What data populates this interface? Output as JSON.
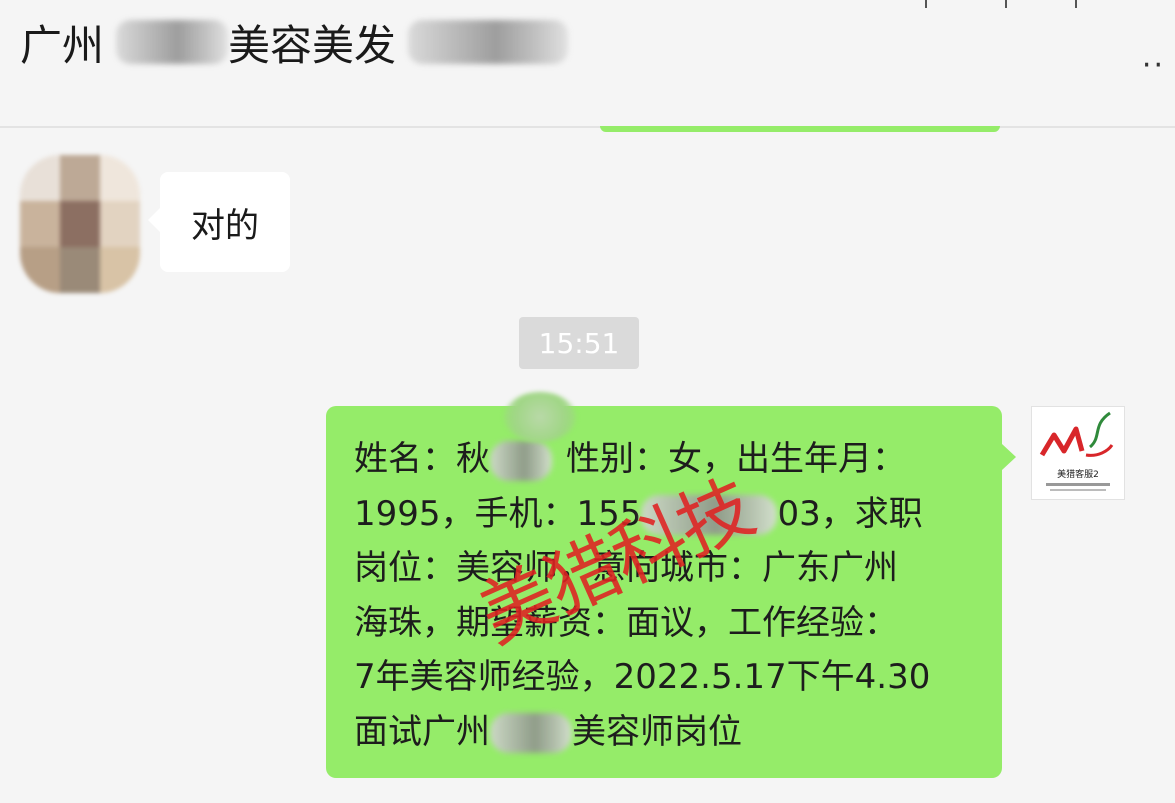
{
  "header": {
    "title_prefix": "广州",
    "title_middle": "美容美发",
    "more_icon": "ellipsis-icon"
  },
  "colors": {
    "self_bubble": "#95ec69",
    "other_bubble": "#ffffff",
    "background": "#f5f5f5",
    "watermark": "#e02222"
  },
  "messages": {
    "incoming_text": "对的",
    "timestamp": "15:51",
    "outgoing_lines": [
      {
        "a": "姓名：秋",
        "b": "性别：女，出生年月："
      },
      {
        "a": "1995，手机：155",
        "b": "03，求职"
      },
      {
        "a": "岗位：美容师，意向城市：广东广州"
      },
      {
        "a": "海珠，期望薪资：面议，工作经验："
      },
      {
        "a": "7年美容师经验，2022.5.17下午4.30"
      },
      {
        "a": "面试广州",
        "b": "美容师岗位"
      }
    ]
  },
  "avatar_right": {
    "logo_caption": "美猎客服2",
    "logo_icon": "meilie-logo-icon"
  },
  "watermark_text": "美猎科技"
}
